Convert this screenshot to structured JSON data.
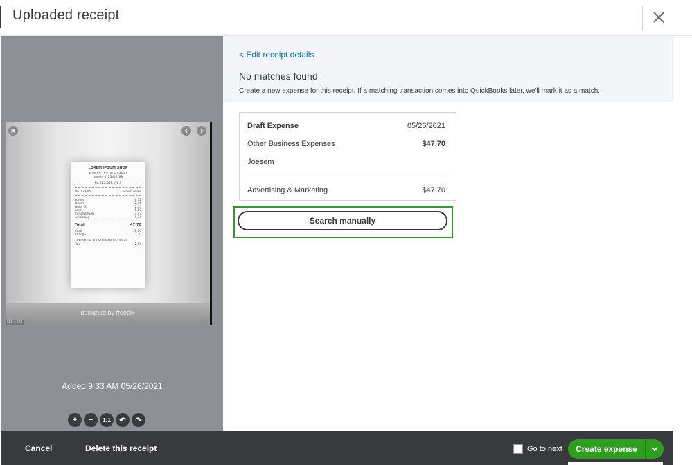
{
  "header": {
    "title": "Uploaded receipt"
  },
  "preview": {
    "added": "Added 9:33 AM 05/26/2021",
    "dimensions": "626 × 626",
    "watermark": "designed by  freepik",
    "zoom": {
      "in": "+",
      "out": "−",
      "reset": "1:1",
      "rotate_left": "↶",
      "rotate_right": "↷"
    },
    "receipt": {
      "shop": "LOREM IPSUM SHOP",
      "address": "ADRESS: DOLOR SIT AMET",
      "phone": "phone: 0123456789",
      "number": "No.01.2.345.678.9",
      "receipt_no": "No. 123/45",
      "cashier": "Cashier: name",
      "items": [
        {
          "name": "Lorem",
          "price": "6,32"
        },
        {
          "name": "Ipsum",
          "price": "12,45"
        },
        {
          "name": "Dolor Sit",
          "price": "2,54"
        },
        {
          "name": "Amet",
          "price": "5,52"
        },
        {
          "name": "Consectetuer",
          "price": "11,43"
        },
        {
          "name": "Adipiscing",
          "price": "9,34"
        }
      ],
      "total_label": "Total",
      "total": "47,70",
      "cash_label": "Cash",
      "cash": "50,00",
      "change_label": "Change",
      "change": "2,30",
      "tax_note": "TAX/VAT INCLUDED IN ABOVE TOTAL",
      "tax_label": "Tax",
      "tax": "2,54"
    }
  },
  "main": {
    "edit_link": "< Edit receipt details",
    "no_matches": "No matches found",
    "description": "Create a new expense for this receipt. If a matching transaction comes into QuickBooks later, we'll mark it as a match.",
    "card": {
      "type": "Draft Expense",
      "date": "05/26/2021",
      "category": "Other Business Expenses",
      "amount": "$47.70",
      "payee": "Joesem",
      "line_category": "Advertising & Marketing",
      "line_amount": "$47.70"
    },
    "search_button": "Search manually"
  },
  "footer": {
    "cancel": "Cancel",
    "delete": "Delete this receipt",
    "go_to_next": "Go to next",
    "create": "Create expense"
  },
  "colors": {
    "accent": "#2ca01c",
    "link": "#0077c5",
    "footer_bg": "#393a3d",
    "text": "#393a3d"
  }
}
